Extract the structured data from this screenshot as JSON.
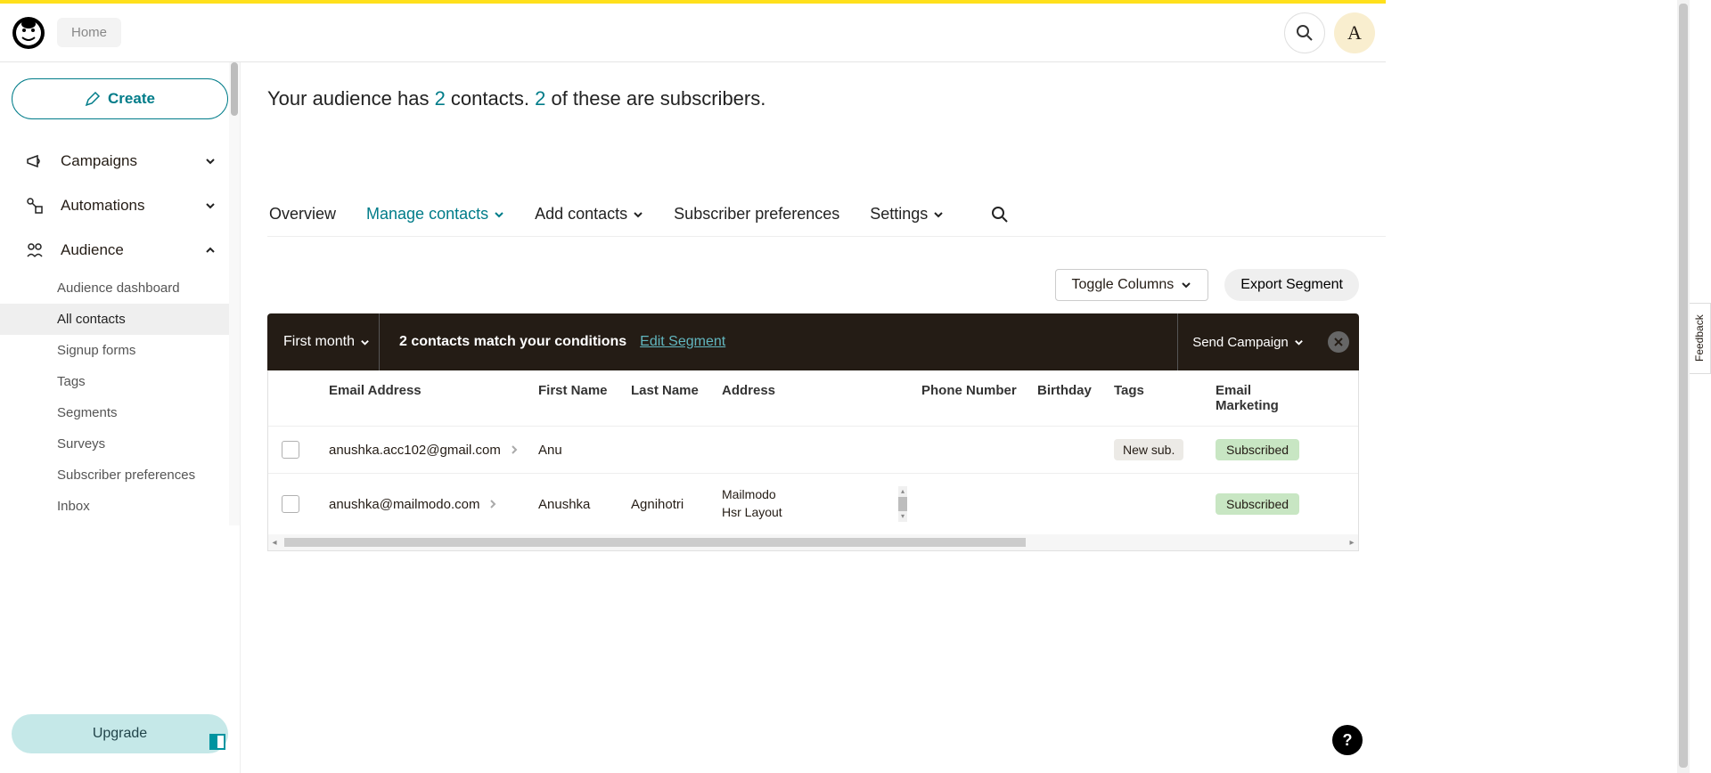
{
  "topbar": {
    "home_label": "Home",
    "avatar_initial": "A"
  },
  "sidebar": {
    "create_label": "Create",
    "nav": {
      "campaigns": "Campaigns",
      "automations": "Automations",
      "audience": "Audience"
    },
    "audience_sub": {
      "dashboard": "Audience dashboard",
      "all_contacts": "All contacts",
      "signup_forms": "Signup forms",
      "tags": "Tags",
      "segments": "Segments",
      "surveys": "Surveys",
      "subscriber_prefs": "Subscriber preferences",
      "inbox": "Inbox"
    },
    "upgrade_label": "Upgrade"
  },
  "main": {
    "stats": {
      "prefix": "Your audience has ",
      "contacts_count": "2",
      "mid1": " contacts. ",
      "subscribers_count": "2",
      "mid2": " of these are subscribers."
    },
    "tabs": {
      "overview": "Overview",
      "manage_contacts": "Manage contacts",
      "add_contacts": "Add contacts",
      "subscriber_prefs": "Subscriber preferences",
      "settings": "Settings"
    },
    "actions": {
      "toggle_columns": "Toggle Columns",
      "export_segment": "Export Segment"
    },
    "segment_bar": {
      "dropdown": "First month",
      "match_text": "2 contacts match your conditions",
      "edit_label": "Edit Segment",
      "send_campaign": "Send Campaign"
    },
    "table": {
      "headers": {
        "email": "Email Address",
        "first_name": "First Name",
        "last_name": "Last Name",
        "address": "Address",
        "phone": "Phone Number",
        "birthday": "Birthday",
        "tags": "Tags",
        "email_marketing": "Email Marketing"
      },
      "rows": [
        {
          "email": "anushka.acc102@gmail.com",
          "first_name": "Anu",
          "last_name": "",
          "address": "",
          "phone": "",
          "birthday": "",
          "tags": "New sub.",
          "email_marketing": "Subscribed"
        },
        {
          "email": "anushka@mailmodo.com",
          "first_name": "Anushka",
          "last_name": "Agnihotri",
          "address": "Mailmodo\nHsr Layout",
          "phone": "",
          "birthday": "",
          "tags": "",
          "email_marketing": "Subscribed"
        }
      ]
    }
  },
  "feedback_label": "Feedback"
}
